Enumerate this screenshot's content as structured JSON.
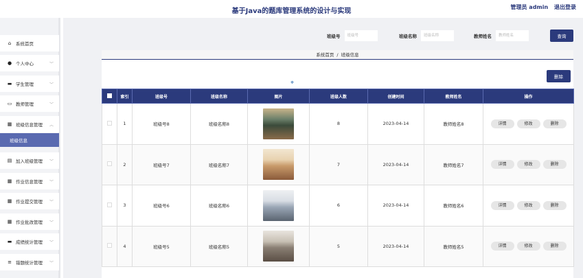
{
  "header": {
    "title": "基于Java的题库管理系统的设计与实现",
    "user": "管理员 admin",
    "logout": "退出登录"
  },
  "sidebar": {
    "items": [
      {
        "label": "系统首页",
        "icon": "home-icon",
        "glyph": "⌂",
        "chev": false
      },
      {
        "label": "个人中心",
        "icon": "person-icon",
        "glyph": "●",
        "chev": true
      },
      {
        "label": "学生管理",
        "icon": "monitor-icon",
        "glyph": "▬",
        "chev": true
      },
      {
        "label": "教师管理",
        "icon": "screen-icon",
        "glyph": "▭",
        "chev": true
      },
      {
        "label": "班级信息管理",
        "icon": "grid-icon",
        "glyph": "▦",
        "chev": true
      },
      {
        "label": "加入班级管理",
        "icon": "clipboard-icon",
        "glyph": "▤",
        "chev": true
      },
      {
        "label": "作业信息管理",
        "icon": "grid-icon",
        "glyph": "▦",
        "chev": true
      },
      {
        "label": "作业提交管理",
        "icon": "grid-icon",
        "glyph": "▦",
        "chev": true
      },
      {
        "label": "作业批改管理",
        "icon": "grid-icon",
        "glyph": "▦",
        "chev": true
      },
      {
        "label": "成绩统计管理",
        "icon": "chat-icon",
        "glyph": "▬",
        "chev": true
      },
      {
        "label": "错题统计管理",
        "icon": "list-icon",
        "glyph": "≡",
        "chev": true
      }
    ],
    "active_sub": "班级信息"
  },
  "search": {
    "fields": [
      {
        "label": "班级号",
        "placeholder": "班级号"
      },
      {
        "label": "班级名称",
        "placeholder": "班级名称"
      },
      {
        "label": "教师姓名",
        "placeholder": "教师姓名"
      }
    ],
    "button": "查询"
  },
  "breadcrumb": {
    "home": "系统首页",
    "sep": "/",
    "current": "班级信息"
  },
  "toolbar": {
    "delete": "删除"
  },
  "table": {
    "headers": [
      "索引",
      "班级号",
      "班级名称",
      "图片",
      "班级人数",
      "创建时间",
      "教师姓名",
      "操作"
    ],
    "rows": [
      {
        "index": "1",
        "code": "班级号8",
        "name": "班级名称8",
        "count": "8",
        "date": "2023-04-14",
        "teacher": "教师姓名8"
      },
      {
        "index": "2",
        "code": "班级号7",
        "name": "班级名称7",
        "count": "7",
        "date": "2023-04-14",
        "teacher": "教师姓名7"
      },
      {
        "index": "3",
        "code": "班级号6",
        "name": "班级名称6",
        "count": "6",
        "date": "2023-04-14",
        "teacher": "教师姓名6"
      },
      {
        "index": "4",
        "code": "班级号5",
        "name": "班级名称5",
        "count": "5",
        "date": "2023-04-14",
        "teacher": "教师姓名5"
      }
    ],
    "actions": [
      "详情",
      "修改",
      "删除"
    ]
  },
  "colors": {
    "brand": "#2b3a7c",
    "active_sub": "#5a6ab0"
  }
}
